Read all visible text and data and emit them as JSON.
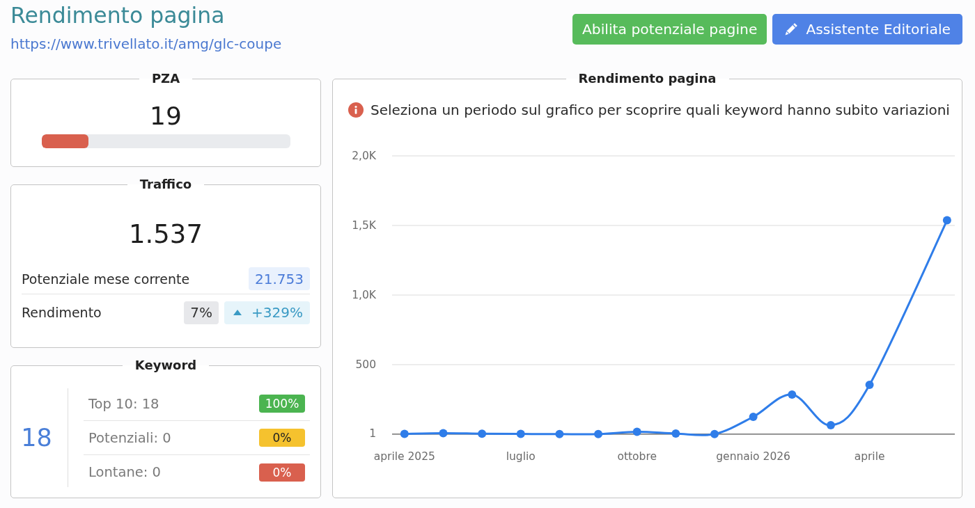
{
  "header": {
    "title": "Rendimento pagina",
    "url": "https://www.trivellato.it/amg/glc-coupe"
  },
  "actions": [
    {
      "label": "Abilita potenziale pagine",
      "kind": "success"
    },
    {
      "label": "Assistente Editoriale",
      "kind": "editor"
    }
  ],
  "pza": {
    "title": "PZA",
    "value": "19",
    "level": 0.19
  },
  "traffic": {
    "title": "Traffico",
    "value": "1.537",
    "rows": [
      {
        "label": "Potenziale mese corrente",
        "badges": [
          {
            "text": "21.753",
            "kind": "info"
          }
        ]
      },
      {
        "label": "Rendimento",
        "badges": [
          {
            "text": "7%",
            "kind": "neutral"
          },
          {
            "text": "+329%",
            "kind": "trend-up"
          }
        ]
      }
    ]
  },
  "keywords": {
    "title": "Keyword",
    "total": "18",
    "rows": [
      {
        "label": "Top 10: 18",
        "badge": "100%",
        "color": "#4bb450"
      },
      {
        "label": "Potenziali: 0",
        "badge": "0%",
        "color": "#f5c22e"
      },
      {
        "label": "Lontane: 0",
        "badge": "0%",
        "color": "#d9604e"
      }
    ]
  },
  "performance": {
    "title": "Rendimento pagina",
    "notice": "Seleziona un periodo sul grafico per scoprire quali keyword hanno subito variazioni",
    "chart_data": {
      "type": "line",
      "grid": true,
      "categories": [
        "aprile 2025",
        null,
        null,
        "luglio",
        null,
        null,
        "ottobre",
        null,
        null,
        "gennaio 2026",
        null,
        null,
        "aprile",
        null,
        null
      ],
      "series": [
        {
          "color": "#2f7de9",
          "marker": true,
          "values": [
            3,
            8,
            4,
            2,
            1,
            1,
            18,
            5,
            1,
            125,
            285,
            65,
            355,
            null,
            1537
          ]
        }
      ],
      "ylim": [
        0,
        2000
      ],
      "yticks": [
        {
          "value": 1,
          "label": "1"
        },
        {
          "value": 500,
          "label": "500"
        },
        {
          "value": 1000,
          "label": "1,0K"
        },
        {
          "value": 1500,
          "label": "1,5K"
        },
        {
          "value": 2000,
          "label": "2,0K"
        }
      ]
    }
  }
}
